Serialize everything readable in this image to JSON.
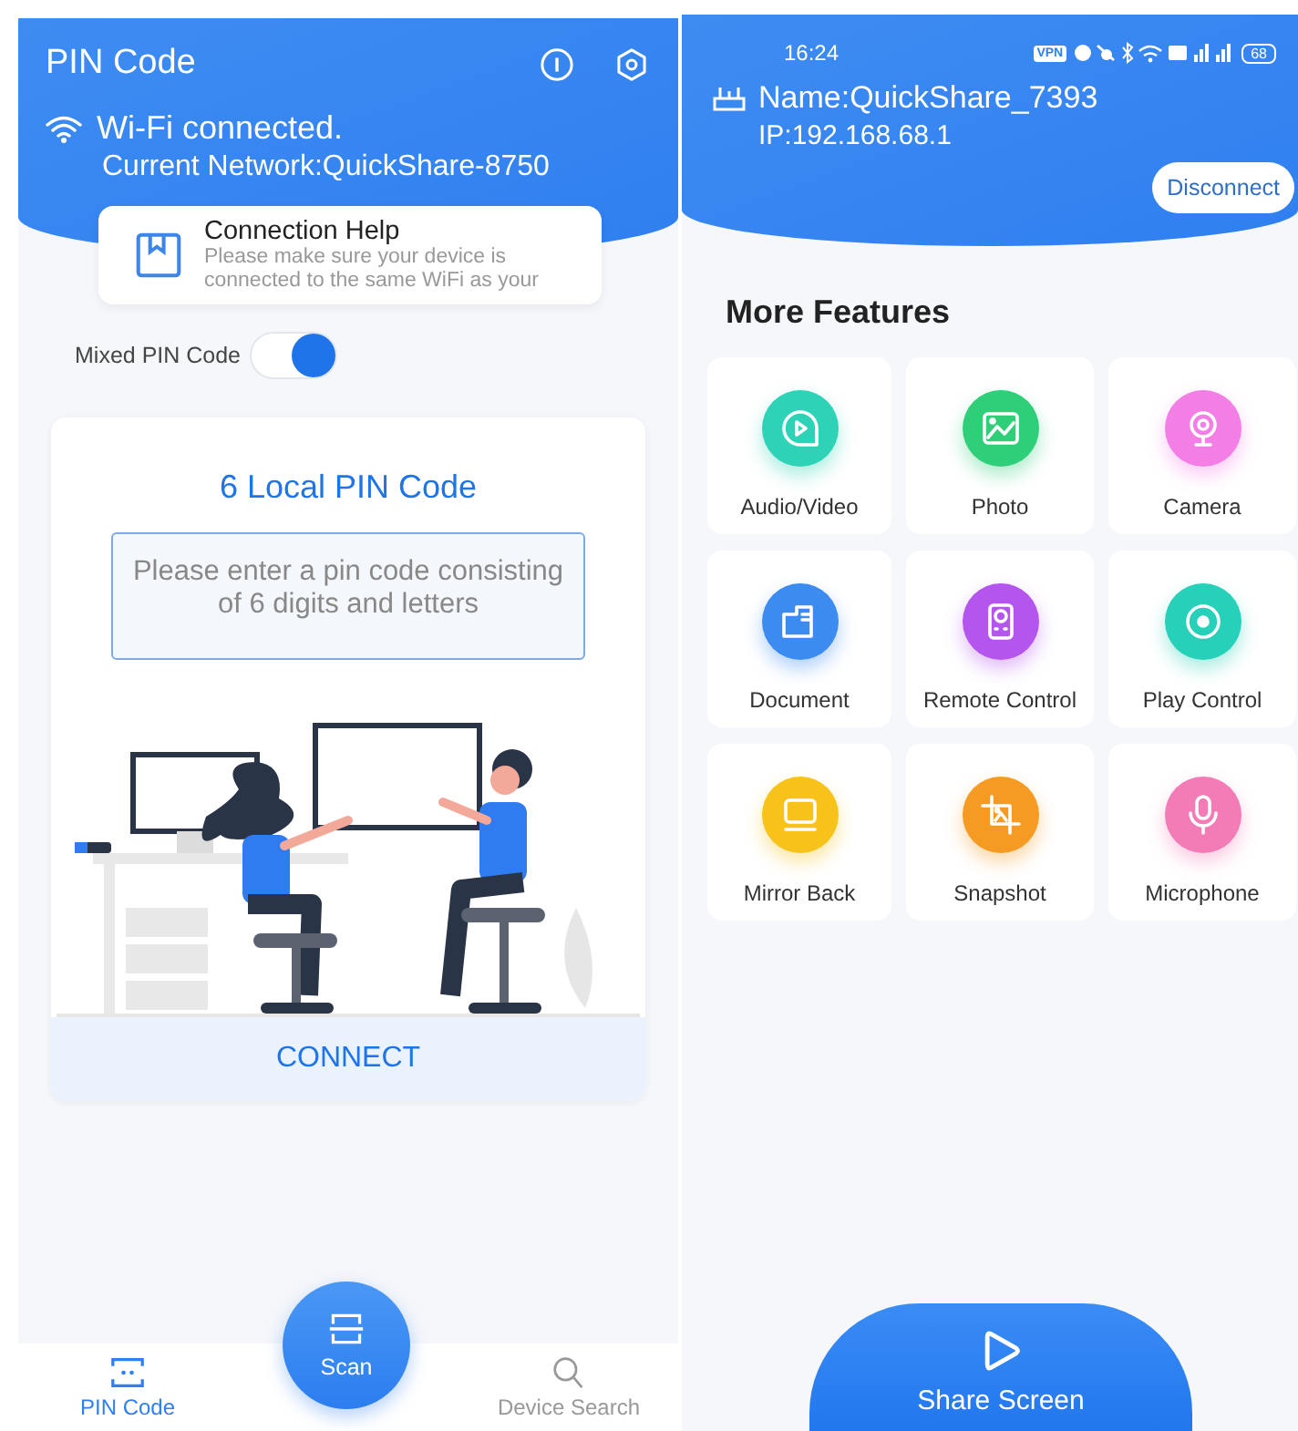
{
  "pin_screen": {
    "title": "PIN Code",
    "wifi_status": "Wi-Fi connected.",
    "network": "Current Network:QuickShare-8750",
    "help_card": {
      "title": "Connection Help",
      "text": "Please make sure your device is connected to the same WiFi as your"
    },
    "mixed_pin": {
      "label": "Mixed PIN Code",
      "on": true
    },
    "pin_card": {
      "title": "6 Local PIN Code",
      "placeholder": "Please enter a pin code consisting of 6 digits and letters",
      "connect": "CONNECT"
    },
    "scan_button": "Scan",
    "tabs": [
      {
        "label": "PIN Code",
        "selected": true
      },
      {
        "label": "Device Search",
        "selected": false
      }
    ]
  },
  "features_screen": {
    "status_bar": {
      "time": "16:24",
      "vpn": "VPN",
      "battery": "68"
    },
    "device_name": "Name:QuickShare_7393",
    "ip": "IP:192.168.68.1",
    "disconnect": "Disconnect",
    "section_title": "More Features",
    "features": [
      {
        "label": "Audio/Video",
        "color": "#2ed3b7"
      },
      {
        "label": "Photo",
        "color": "#2fcf7a"
      },
      {
        "label": "Camera",
        "color": "#f27ee6"
      },
      {
        "label": "Document",
        "color": "#3b8bf0"
      },
      {
        "label": "Remote Control",
        "color": "#b455ee"
      },
      {
        "label": "Play Control",
        "color": "#27d0b8"
      },
      {
        "label": "Mirror Back",
        "color": "#f7c21a"
      },
      {
        "label": "Snapshot",
        "color": "#f59a22"
      },
      {
        "label": "Microphone",
        "color": "#f47cb6"
      }
    ],
    "share_button": "Share Screen"
  }
}
